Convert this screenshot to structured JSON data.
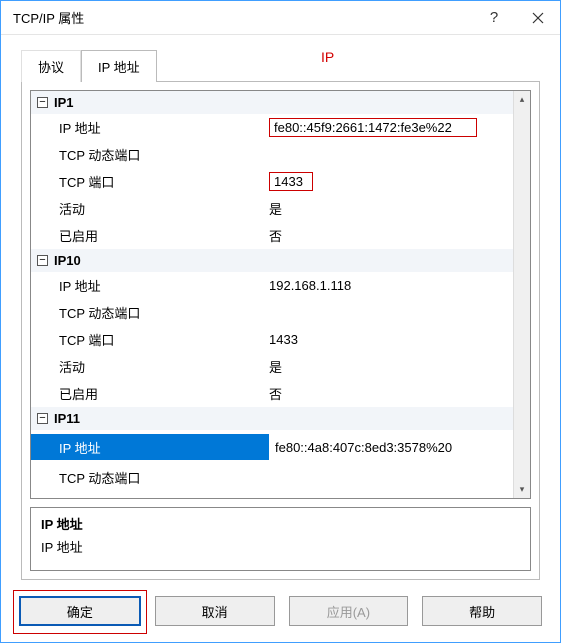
{
  "window": {
    "title": "TCP/IP 属性",
    "help_glyph": "?",
    "close_glyph": "×"
  },
  "tabs": {
    "protocol": "协议",
    "ip_addresses": "IP 地址"
  },
  "annotation": {
    "ip": "IP"
  },
  "grid": {
    "ip1": {
      "header": "IP1",
      "ip_addr_label": "IP 地址",
      "ip_addr_value": "fe80::45f9:2661:1472:fe3e%22",
      "tcp_dyn_label": "TCP 动态端口",
      "tcp_dyn_value": "",
      "tcp_port_label": "TCP 端口",
      "tcp_port_value": "1433",
      "active_label": "活动",
      "active_value": "是",
      "enabled_label": "已启用",
      "enabled_value": "否"
    },
    "ip10": {
      "header": "IP10",
      "ip_addr_label": "IP 地址",
      "ip_addr_value": "192.168.1.118",
      "tcp_dyn_label": "TCP 动态端口",
      "tcp_dyn_value": "",
      "tcp_port_label": "TCP 端口",
      "tcp_port_value": "1433",
      "active_label": "活动",
      "active_value": "是",
      "enabled_label": "已启用",
      "enabled_value": "否"
    },
    "ip11": {
      "header": "IP11",
      "ip_addr_label": "IP 地址",
      "ip_addr_value": "fe80::4a8:407c:8ed3:3578%20",
      "tcp_dyn_label": "TCP 动态端口",
      "tcp_dyn_value": ""
    }
  },
  "description": {
    "title": "IP 地址",
    "text": "IP 地址"
  },
  "buttons": {
    "ok": "确定",
    "cancel": "取消",
    "apply": "应用(A)",
    "help": "帮助"
  },
  "scroll": {
    "up": "▴",
    "down": "▾"
  },
  "toggle_glyph": "−"
}
